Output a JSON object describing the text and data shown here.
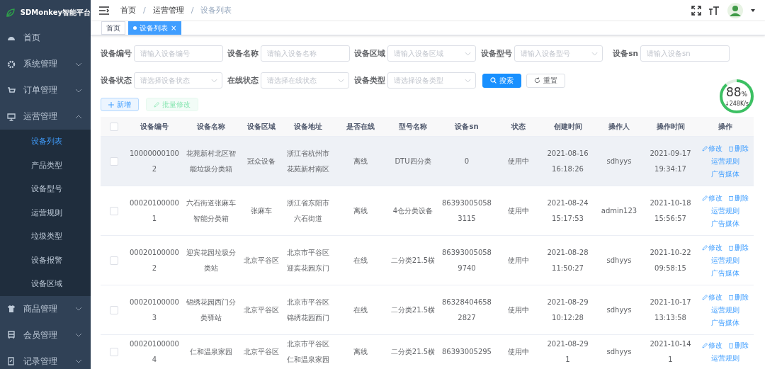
{
  "sidebar": {
    "title": "SDMonkey智能平台",
    "items": [
      {
        "label": "首页",
        "kind": "link",
        "selected": false
      },
      {
        "label": "系统管理",
        "kind": "group",
        "expanded": false
      },
      {
        "label": "订单管理",
        "kind": "group",
        "expanded": false
      },
      {
        "label": "运营管理",
        "kind": "group",
        "expanded": true,
        "children": [
          {
            "label": "设备列表",
            "selected": true
          },
          {
            "label": "产品类型",
            "selected": false
          },
          {
            "label": "设备型号",
            "selected": false
          },
          {
            "label": "运营规则",
            "selected": false
          },
          {
            "label": "垃圾类型",
            "selected": false
          },
          {
            "label": "设备报警",
            "selected": false
          },
          {
            "label": "设备区域",
            "selected": false
          }
        ]
      },
      {
        "label": "商品管理",
        "kind": "group",
        "expanded": false
      },
      {
        "label": "会员管理",
        "kind": "group",
        "expanded": false
      },
      {
        "label": "记录管理",
        "kind": "group",
        "expanded": false
      }
    ]
  },
  "breadcrumb": [
    {
      "label": "首页",
      "kind": "link"
    },
    {
      "label": "/",
      "kind": "separator"
    },
    {
      "label": "运营管理",
      "kind": "link"
    },
    {
      "label": "/",
      "kind": "separator"
    },
    {
      "label": "设备列表",
      "kind": "current"
    }
  ],
  "tabs": [
    {
      "label": "首页",
      "selected": false
    },
    {
      "label": "设备列表",
      "selected": true,
      "close": "×"
    }
  ],
  "filters": [
    {
      "label": "设备编号",
      "kind": "input",
      "placeholder": "请输入设备编号"
    },
    {
      "label": "设备名称",
      "kind": "input",
      "placeholder": "请输入设备名称"
    },
    {
      "label": "设备区域",
      "kind": "select",
      "placeholder": "请输入设备区域"
    },
    {
      "label": "设备型号",
      "kind": "select",
      "placeholder": "请输入设备型号"
    },
    {
      "label": "设备sn",
      "kind": "input",
      "placeholder": "请输入设备sn"
    },
    {
      "label": "设备状态",
      "kind": "select",
      "placeholder": "请选择设备状态"
    },
    {
      "label": "在线状态",
      "kind": "select",
      "placeholder": "请选择在线状态"
    },
    {
      "label": "设备类型",
      "kind": "select",
      "placeholder": "请选择设备类型"
    }
  ],
  "search_buttons": [
    {
      "label": "搜索",
      "kind": "primary"
    },
    {
      "label": "重置",
      "kind": "plain"
    }
  ],
  "toolbar_buttons": [
    {
      "label": "新增",
      "kind": "add",
      "disabled": false
    },
    {
      "label": "批量修改",
      "kind": "edit",
      "disabled": true
    }
  ],
  "table": {
    "header_checked": false,
    "columns": [
      "设备编号",
      "设备名称",
      "设备区域",
      "设备地址",
      "是否在线",
      "型号名称",
      "设备sn",
      "状态",
      "创建时间",
      "操作人",
      "操作时间",
      "操作"
    ],
    "rows": [
      {
        "checked": false,
        "highlighted": true,
        "cells": [
          "100000001002",
          "花苑新村北区智能垃圾分类箱",
          "冠众设备",
          "浙江省杭州市花苑新村南区",
          "离线",
          "DTU四分类",
          "0",
          "使用中",
          "2021-08-16 16:18:26",
          "sdhyys",
          "2021-09-17 19:34:17"
        ],
        "actions": [
          {
            "label": "修改",
            "kind": "edit"
          },
          {
            "label": "删除",
            "kind": "delete"
          },
          {
            "label": "运营规则",
            "kind": "link"
          },
          {
            "label": "广告媒体",
            "kind": "link"
          }
        ]
      },
      {
        "checked": false,
        "highlighted": false,
        "cells": [
          "000201000001",
          "六石街道张麻车智能分类箱",
          "张麻车",
          "浙江省东阳市六石街道",
          "离线",
          "4仓分类设备",
          "863930050583115",
          "使用中",
          "2021-08-24 15:17:53",
          "admin123",
          "2021-10-18 15:56:57"
        ],
        "actions": [
          {
            "label": "修改",
            "kind": "edit"
          },
          {
            "label": "删除",
            "kind": "delete"
          },
          {
            "label": "运营规则",
            "kind": "link"
          },
          {
            "label": "广告媒体",
            "kind": "link"
          }
        ]
      },
      {
        "checked": false,
        "highlighted": false,
        "cells": [
          "000201000002",
          "迎宾花园垃圾分类站",
          "北京平谷区",
          "北京市平谷区迎宾花园东门",
          "在线",
          "二分类21.5横",
          "863930050589740",
          "使用中",
          "2021-08-28 11:50:27",
          "sdhyys",
          "2021-10-22 09:58:15"
        ],
        "actions": [
          {
            "label": "修改",
            "kind": "edit"
          },
          {
            "label": "删除",
            "kind": "delete"
          },
          {
            "label": "运营规则",
            "kind": "link"
          },
          {
            "label": "广告媒体",
            "kind": "link"
          }
        ]
      },
      {
        "checked": false,
        "highlighted": false,
        "cells": [
          "000201000003",
          "锦绣花园西门分类驿站",
          "北京平谷区",
          "北京市平谷区锦绣花园西门",
          "在线",
          "二分类21.5横",
          "863284046582827",
          "使用中",
          "2021-08-29 10:12:28",
          "sdhyys",
          "2021-10-17 13:13:58"
        ],
        "actions": [
          {
            "label": "修改",
            "kind": "edit"
          },
          {
            "label": "删除",
            "kind": "delete"
          },
          {
            "label": "运营规则",
            "kind": "link"
          },
          {
            "label": "广告媒体",
            "kind": "link"
          }
        ]
      },
      {
        "checked": false,
        "highlighted": false,
        "cells": [
          "000201000004",
          "仁和温泉家园",
          "北京平谷区",
          "北京市平谷区仁和温泉家园",
          "离线",
          "二分类21.5横",
          "86393005295",
          "使用中",
          "2021-08-29 1",
          "sdhyys",
          "2021-10-14 1"
        ],
        "actions": [
          {
            "label": "修改",
            "kind": "edit"
          },
          {
            "label": "删除",
            "kind": "delete"
          },
          {
            "label": "运营规则",
            "kind": "link"
          }
        ]
      }
    ]
  },
  "speed_widget": {
    "percent": "88",
    "unit": "%",
    "speed": "↓248K/s"
  }
}
